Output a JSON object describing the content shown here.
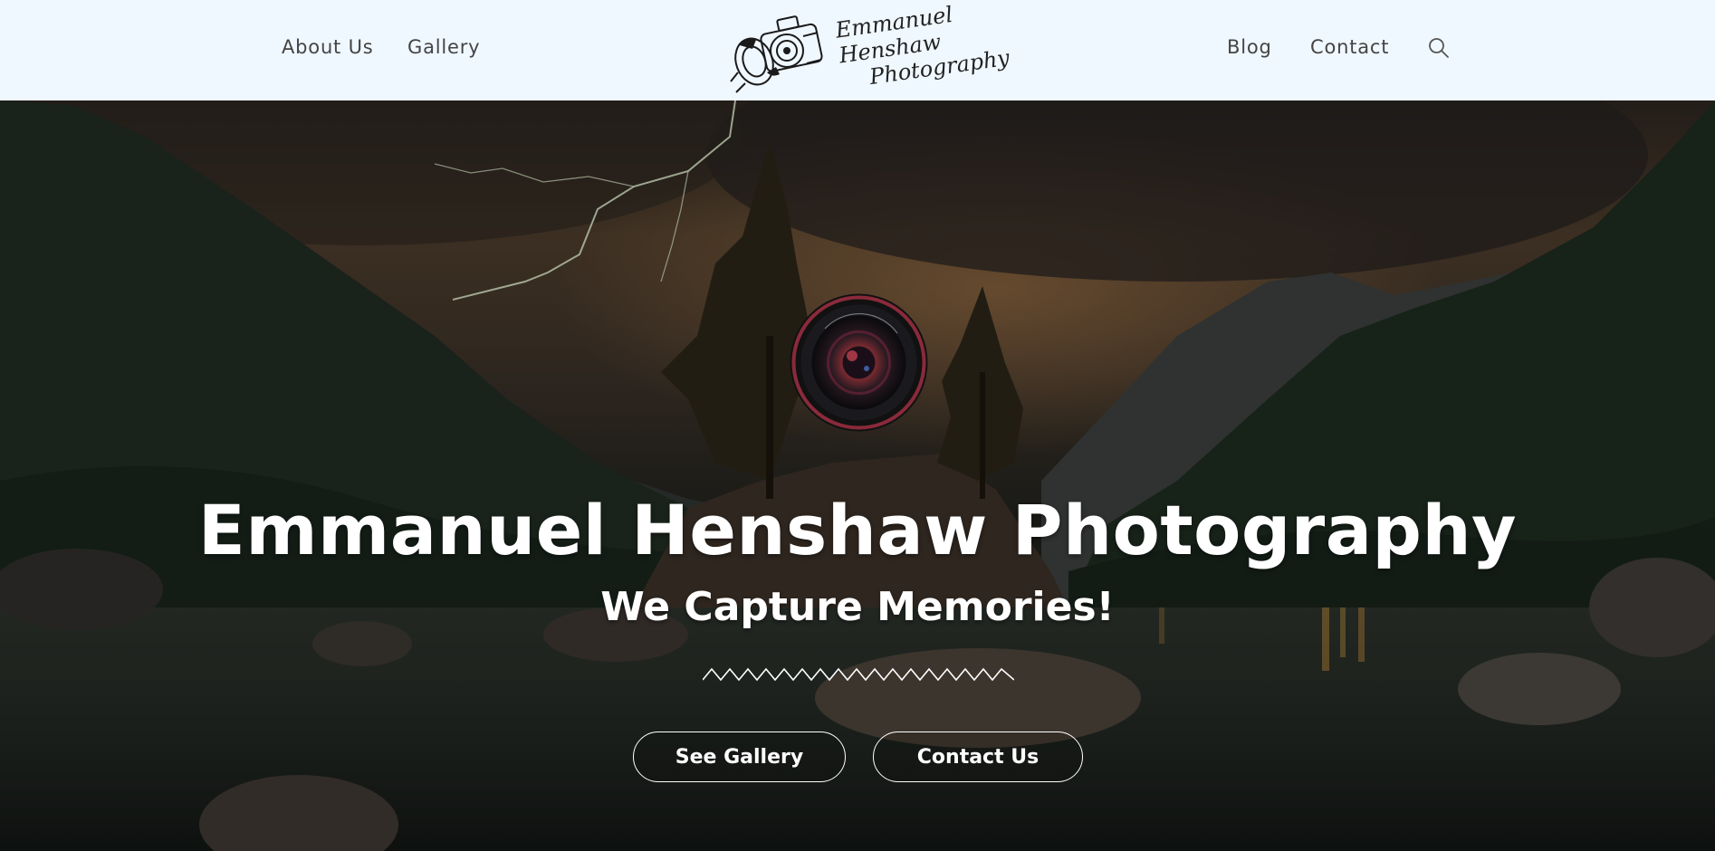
{
  "header": {
    "nav_left": [
      {
        "label": "About Us"
      },
      {
        "label": "Gallery"
      }
    ],
    "nav_right": [
      {
        "label": "Blog"
      },
      {
        "label": "Contact"
      }
    ],
    "logo": {
      "line1": "Emmanuel Henshaw",
      "line2": "Photography"
    },
    "search_icon": "search-icon"
  },
  "hero": {
    "title": "Emmanuel Henshaw Photography",
    "subtitle": "We Capture Memories!",
    "buttons": [
      {
        "label": "See Gallery"
      },
      {
        "label": "Contact Us"
      }
    ]
  },
  "colors": {
    "header_bg": "#f0f8ff",
    "nav_text": "#444444",
    "hero_text": "#ffffff"
  }
}
